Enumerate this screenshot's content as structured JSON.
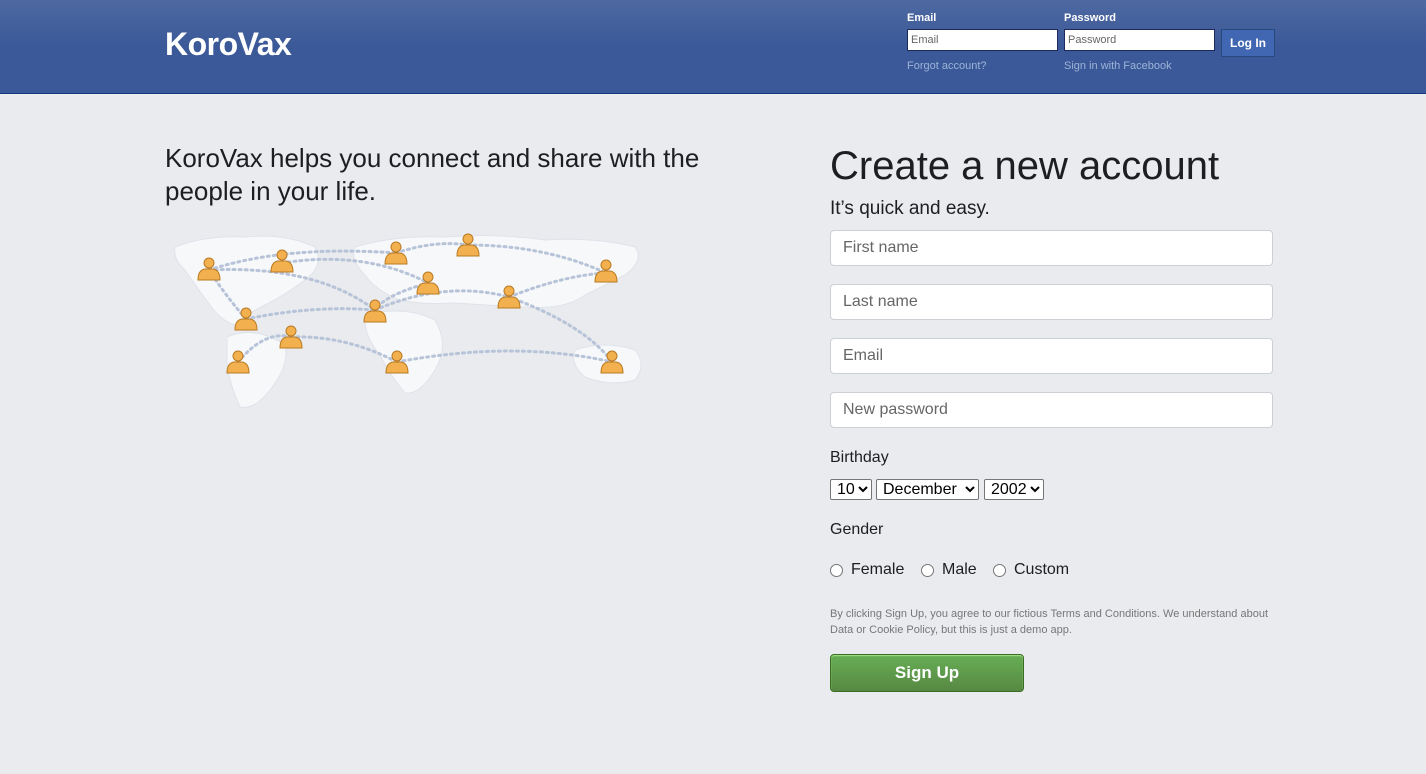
{
  "header": {
    "logo": "KoroVax",
    "email_label": "Email",
    "email_placeholder": "Email",
    "password_label": "Password",
    "password_placeholder": "Password",
    "login_button": "Log In",
    "forgot_link": "Forgot account?",
    "facebook_link": "Sign in with Facebook"
  },
  "left": {
    "tagline": "KoroVax helps you connect and share with the people in your life."
  },
  "signup": {
    "title": "Create a new account",
    "subtitle": "It’s quick and easy.",
    "first_name_placeholder": "First name",
    "last_name_placeholder": "Last name",
    "email_placeholder": "Email",
    "password_placeholder": "New password",
    "birthday_label": "Birthday",
    "birthday_day": "10",
    "birthday_month": "December",
    "birthday_year": "2002",
    "gender_label": "Gender",
    "gender_options": [
      "Female",
      "Male",
      "Custom"
    ],
    "terms": "By clicking Sign Up, you agree to our fictious Terms and Conditions. We understand about Data or Cookie Policy, but this is just a demo app.",
    "signup_button": "Sign Up"
  },
  "colors": {
    "header_bg": "#3b5998",
    "page_bg": "#e9ebee",
    "signup_green": "#5fa04d",
    "link_blue": "#9cb4d8"
  }
}
